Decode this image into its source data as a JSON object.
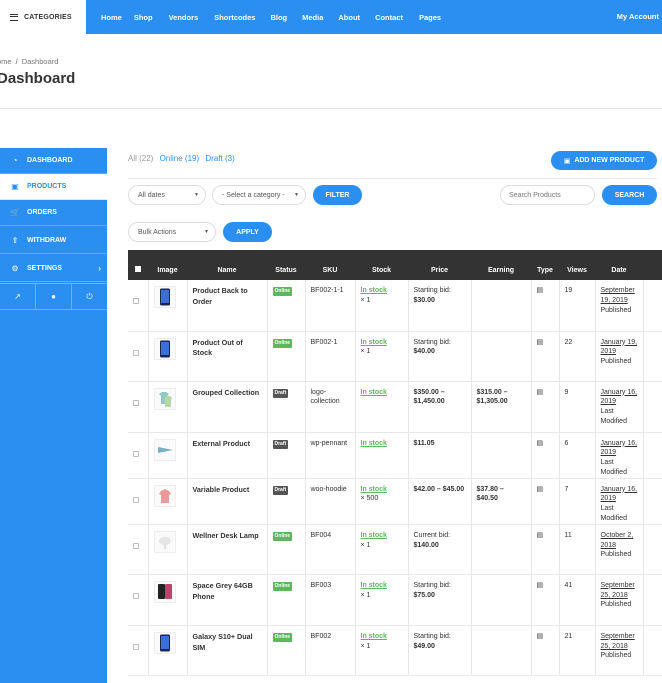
{
  "topbar": {
    "categories_label": "CATEGORIES",
    "nav": [
      "Home",
      "Shop",
      "Vendors",
      "Shortcodes",
      "Blog",
      "Media",
      "About",
      "Contact",
      "Pages"
    ],
    "account_label": "My Account"
  },
  "breadcrumb": {
    "home": "ome",
    "current": "Dashboard"
  },
  "page_title": "Dashboard",
  "sidebar": {
    "items": [
      {
        "label": "DASHBOARD",
        "icon": "dashboard-gauge-icon"
      },
      {
        "label": "PRODUCTS",
        "icon": "briefcase-icon"
      },
      {
        "label": "ORDERS",
        "icon": "cart-icon"
      },
      {
        "label": "WITHDRAW",
        "icon": "upload-icon"
      },
      {
        "label": "SETTINGS",
        "icon": "gear-icon"
      }
    ],
    "footer_icons": [
      "external-link-icon",
      "user-icon",
      "power-icon"
    ]
  },
  "status_filter": {
    "all": "All (22)",
    "online": "Online (19)",
    "draft": "Draft (3)"
  },
  "add_new_label": "ADD NEW PRODUCT",
  "filters": {
    "dates": "All dates",
    "category": "- Select a category -",
    "filter_label": "FILTER",
    "search_placeholder": "Search Products",
    "search_label": "SEARCH",
    "bulk": "Bulk Actions",
    "apply_label": "APPLY"
  },
  "table": {
    "headers": [
      "Image",
      "Name",
      "Status",
      "SKU",
      "Stock",
      "Price",
      "Earning",
      "Type",
      "Views",
      "Date"
    ],
    "rows": [
      {
        "name": "Product Back to Order",
        "status": "Online",
        "sku": "BF002-1-1",
        "stock": "In stock",
        "qty": "× 1",
        "price": "Starting bid: $30.00",
        "earning": "",
        "views": "19",
        "date": "September 19, 2019",
        "date_status": "Published",
        "img": "phone"
      },
      {
        "name": "Product Out of Stock",
        "status": "Online",
        "sku": "BF002-1",
        "stock": "In stock",
        "qty": "× 1",
        "price": "Starting bid: $40.00",
        "earning": "",
        "views": "22",
        "date": "January 19, 2019",
        "date_status": "Published",
        "img": "phone"
      },
      {
        "name": "Grouped Collection",
        "status": "Draft",
        "sku": "logo-collection",
        "stock": "In stock",
        "qty": "",
        "price": "$350.00 – $1,450.00",
        "earning": "$315.00 – $1,305.00",
        "views": "9",
        "date": "January 16, 2019",
        "date_status": "Last Modified",
        "img": "tshirts"
      },
      {
        "name": "External Product",
        "status": "Draft",
        "sku": "wp-pennant",
        "stock": "In stock",
        "qty": "",
        "price": "$11.05",
        "earning": "",
        "views": "6",
        "date": "January 16, 2019",
        "date_status": "Last Modified",
        "img": "pennant"
      },
      {
        "name": "Variable Product",
        "status": "Draft",
        "sku": "woo-hoodie",
        "stock": "In stock",
        "qty": "× 500",
        "price": "$42.00 – $45.00",
        "earning": "$37.80 – $40.50",
        "views": "7",
        "date": "January 16, 2019",
        "date_status": "Last Modified",
        "img": "hoodie"
      },
      {
        "name": "Wellner Desk Lamp",
        "status": "Online",
        "sku": "BF004",
        "stock": "In stock",
        "qty": "× 1",
        "price": "Current bid: $140.00",
        "earning": "",
        "views": "11",
        "date": "October 2, 2018",
        "date_status": "Published",
        "img": "lamp"
      },
      {
        "name": "Space Grey 64GB Phone",
        "status": "Online",
        "sku": "BF003",
        "stock": "In stock",
        "qty": "× 1",
        "price": "Starting bid: $75.00",
        "earning": "",
        "views": "41",
        "date": "September 25, 2018",
        "date_status": "Published",
        "img": "iphone"
      },
      {
        "name": "Galaxy S10+ Dual SIM",
        "status": "Online",
        "sku": "BF002",
        "stock": "In stock",
        "qty": "× 1",
        "price": "Starting bid: $49.00",
        "earning": "",
        "views": "21",
        "date": "September 25, 2018",
        "date_status": "Published",
        "img": "phone"
      }
    ]
  },
  "colors": {
    "accent": "#2a8ff0",
    "online": "#5cb85c",
    "draft": "#555555",
    "header": "#333333"
  }
}
